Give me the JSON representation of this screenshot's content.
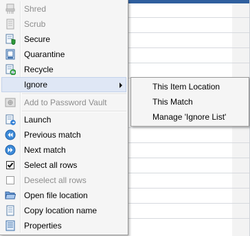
{
  "context_menu": {
    "items": [
      {
        "label": "Shred",
        "icon": "shred-icon",
        "disabled": true
      },
      {
        "label": "Scrub",
        "icon": "scrub-icon",
        "disabled": true
      },
      {
        "label": "Secure",
        "icon": "secure-icon",
        "disabled": false
      },
      {
        "label": "Quarantine",
        "icon": "quarantine-icon",
        "disabled": false
      },
      {
        "label": "Recycle",
        "icon": "recycle-icon",
        "disabled": false
      },
      {
        "label": "Ignore",
        "icon": "",
        "disabled": false,
        "has_submenu": true,
        "highlighted": true
      },
      {
        "label": "Add to Password Vault",
        "icon": "password-vault-icon",
        "disabled": true
      },
      {
        "label": "Launch",
        "icon": "launch-icon",
        "disabled": false
      },
      {
        "label": "Previous match",
        "icon": "previous-match-icon",
        "disabled": false
      },
      {
        "label": "Next match",
        "icon": "next-match-icon",
        "disabled": false
      },
      {
        "label": "Select all rows",
        "icon": "checkbox-checked-icon",
        "disabled": false
      },
      {
        "label": "Deselect all rows",
        "icon": "checkbox-empty-icon",
        "disabled": true
      },
      {
        "label": "Open file location",
        "icon": "folder-icon",
        "disabled": false
      },
      {
        "label": "Copy location name",
        "icon": "document-icon",
        "disabled": false
      },
      {
        "label": "Properties",
        "icon": "properties-icon",
        "disabled": false
      }
    ]
  },
  "ignore_submenu": {
    "items": [
      {
        "label": "This Item Location"
      },
      {
        "label": "This Match"
      },
      {
        "label": "Manage 'Ignore List'"
      }
    ]
  },
  "colors": {
    "menu_bg": "#f5f5f5",
    "highlight_bg": "#dfe7f5",
    "disabled_text": "#8d8d8d",
    "accent_blue": "#2a7bd4"
  }
}
